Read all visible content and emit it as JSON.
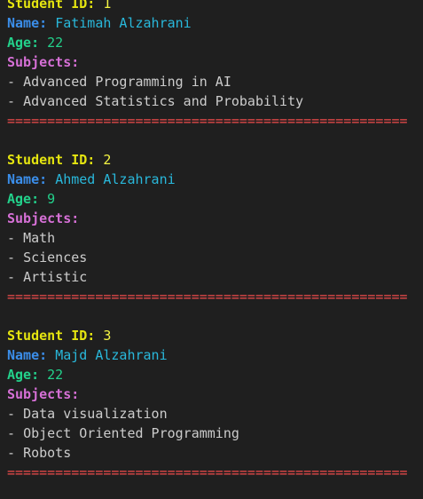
{
  "labels": {
    "student_id": "Student ID:",
    "name": "Name:",
    "age": "Age:",
    "subjects": "Subjects:"
  },
  "bullet": "- ",
  "separator": "==================================================",
  "colors": {
    "background": "#1f1f1f",
    "student_id_label": "#e5e510",
    "name_label": "#3b8eea",
    "age_label": "#23d18b",
    "subjects_label": "#d670d6",
    "separator": "#f14c4c"
  },
  "students": [
    {
      "id": "1",
      "name": "Fatimah Alzahrani",
      "age": "22",
      "subjects": [
        "Advanced Programming in AI",
        "Advanced Statistics and Probability"
      ]
    },
    {
      "id": "2",
      "name": "Ahmed Alzahrani",
      "age": "9",
      "subjects": [
        "Math",
        "Sciences",
        "Artistic"
      ]
    },
    {
      "id": "3",
      "name": "Majd Alzahrani",
      "age": "22",
      "subjects": [
        "Data visualization",
        "Object Oriented Programming",
        "Robots"
      ]
    }
  ]
}
